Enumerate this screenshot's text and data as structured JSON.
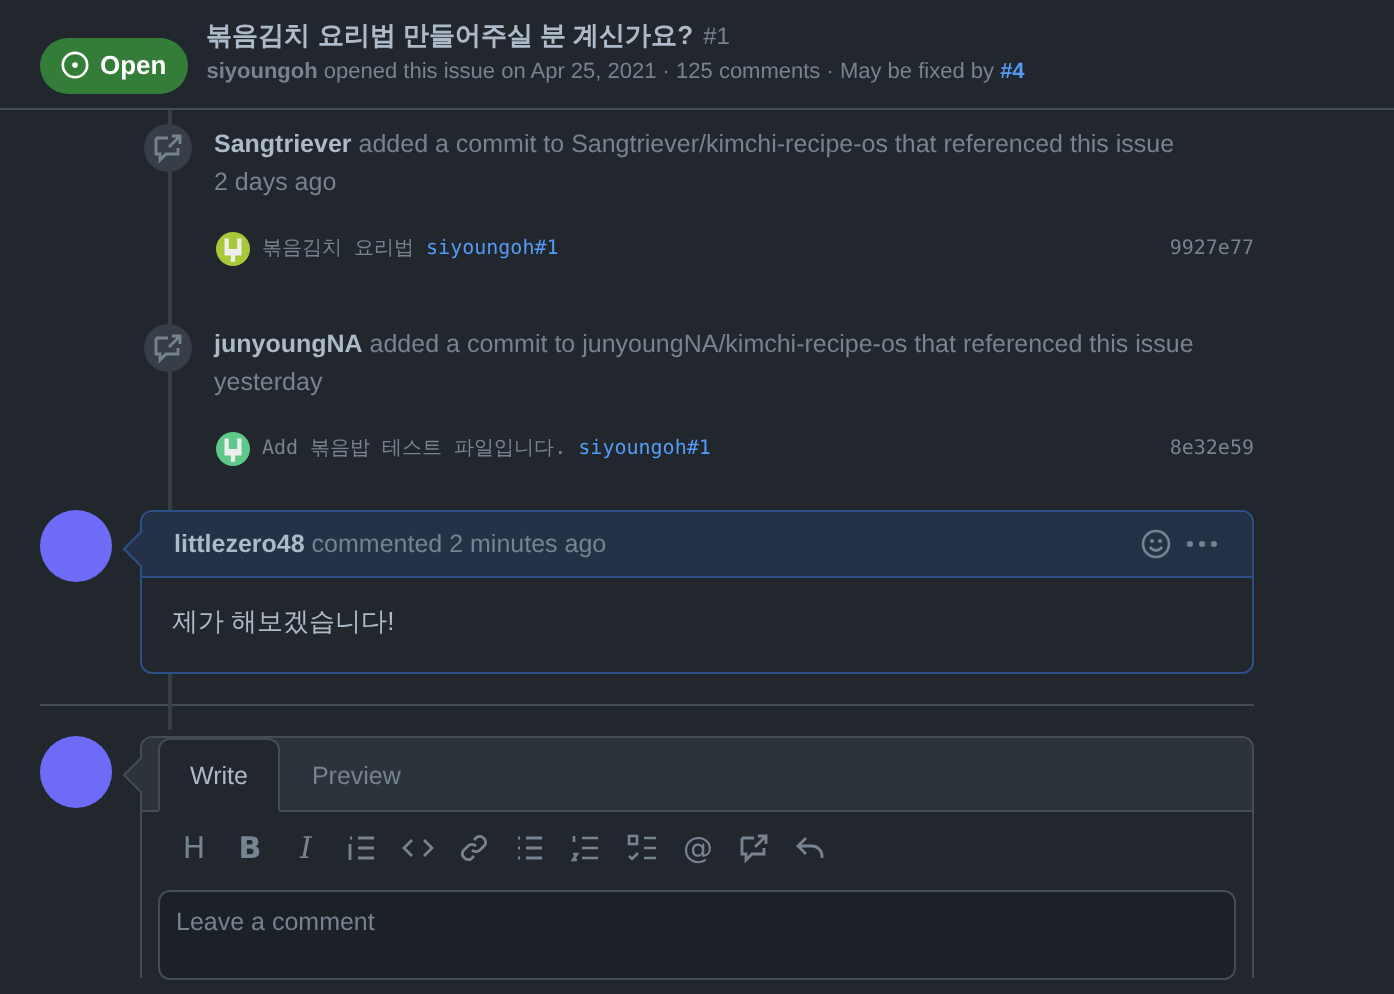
{
  "issue": {
    "state": "Open",
    "title": "볶음김치 요리법 만들어주실 분 계신가요?",
    "number": "#1",
    "author": "siyoungoh",
    "meta": "opened this issue on Apr 25, 2021 · 125 comments · May be fixed by",
    "fix_link": "#4"
  },
  "events": [
    {
      "actor": "Sangtriever",
      "text": "added a commit to Sangtriever/kimchi-recipe-os that referenced this issue",
      "time": "2 days ago",
      "commit": {
        "color": "#a8c93a",
        "message": "볶음김치 요리법",
        "ref": "siyoungoh#1",
        "sha": "9927e77"
      }
    },
    {
      "actor": "junyoungNA",
      "text": "added a commit to junyoungNA/kimchi-recipe-os that referenced this issue",
      "time": "yesterday",
      "commit": {
        "color": "#5ec98a",
        "message": "Add 볶음밥 테스트 파일입니다.",
        "ref": "siyoungoh#1",
        "sha": "8e32e59"
      }
    }
  ],
  "comment": {
    "author": "littlezero48",
    "action": "commented 2 minutes ago",
    "body": "제가 해보겠습니다!"
  },
  "editor": {
    "tabs": [
      {
        "label": "Write",
        "selected": true
      },
      {
        "label": "Preview",
        "selected": false
      }
    ],
    "toolbar": [
      {
        "kind": "text",
        "text": "H"
      },
      {
        "kind": "text",
        "text": "B"
      },
      {
        "kind": "text",
        "text": "I"
      },
      {
        "kind": "icon"
      },
      {
        "kind": "icon"
      },
      {
        "kind": "icon"
      },
      {
        "kind": "icon"
      },
      {
        "kind": "icon"
      },
      {
        "kind": "icon"
      },
      {
        "kind": "text",
        "text": "@"
      },
      {
        "kind": "icon"
      },
      {
        "kind": "icon"
      }
    ],
    "placeholder": "Leave a comment"
  }
}
